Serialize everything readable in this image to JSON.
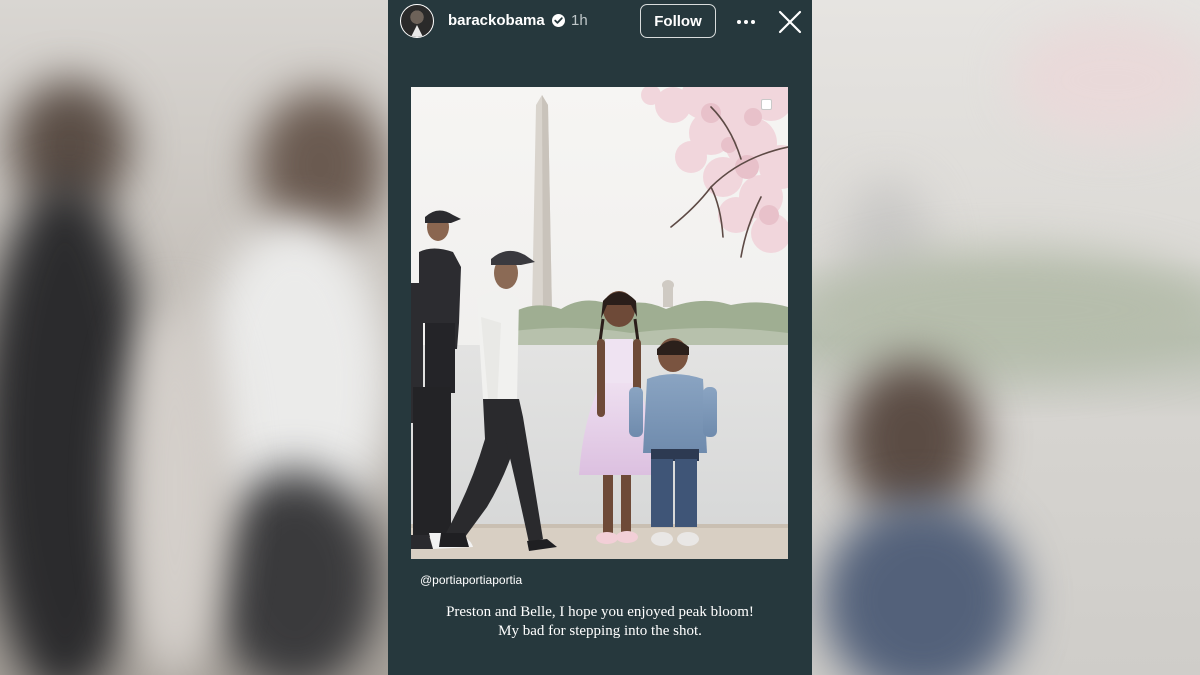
{
  "story": {
    "username": "barackobama",
    "verified": true,
    "time_ago": "1h",
    "follow_label": "Follow",
    "icons": {
      "avatar": "profile-avatar",
      "verified": "verified-badge-icon",
      "more": "more-options-icon",
      "close": "close-icon",
      "corner": "square-icon"
    },
    "mention": "@portiaportiaportia",
    "caption_lines": [
      "Preston and Belle, I hope you enjoyed peak bloom!",
      "My bad for stepping into the shot."
    ]
  },
  "colors": {
    "story_background": "#26383d",
    "text": "#ffffff",
    "verified_badge": "#ffffff"
  }
}
